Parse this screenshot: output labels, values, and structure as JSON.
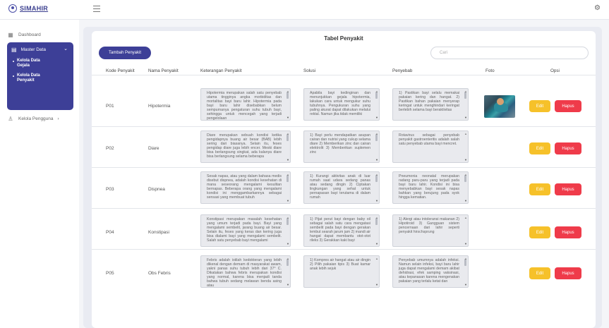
{
  "app": {
    "name": "SIMAHIR"
  },
  "sidebar": {
    "dashboard": "Dashboard",
    "master_data": "Master Data",
    "sub_items": [
      "Kelola Data Gejala",
      "Kelola Data Penyakit"
    ],
    "kelola_pengguna": "Kelola Pengguna"
  },
  "main": {
    "title": "Tabel Penyakit",
    "add_button": "Tambah Penyakit",
    "search_placeholder": "Cari",
    "columns": [
      "Kode Penyakit",
      "Nama Penyakit",
      "Keterangan Penyakit",
      "Solusi",
      "Penyebab",
      "Foto",
      "Opsi"
    ],
    "edit_label": "Edit",
    "delete_label": "Hapus",
    "rows": [
      {
        "kode": "P01",
        "nama": "Hipotermia",
        "keterangan": "Hipotermia merupakan salah satu penyebab utama tingginya angka morbiditas dan mortalitas bayi baru lahir. Hipotermia pada bayi baru lahir disebabkan belum sempurnanya pengaturan suhu tubuh bayi, sehingga untuk mencegah yang terjadi pengelolaan",
        "solusi": "Apabila bayi kedinginan dan menunjukkan gejala hipotermia, lakukan cara untuk mengukur suhu tubuhnya. Pengukuran suhu yang paling akurat dapat dilakukan melalui rektal. Namun jika tidak memiliki",
        "penyebab": "1) Pastikan bayi selalu memakai pakaian kering dan hangat. 2) Pastikan bahan pakaian menyerap keringat untuk menghindari keringat berlebih selama bayi beraktivitas",
        "has_photo": true
      },
      {
        "kode": "P02",
        "nama": "Diare",
        "keterangan": "Diare merupakan sebuah kondisi ketika pengidapnya buang air besar (BAB) lebih sering dari biasanya. Selain itu, feses pengidap diare juga lebih encer. Meski diare bisa berlangsung singkat, ada kalanya diare bisa berlangsung selama beberapa",
        "solusi": "1) Bayi perlu mendapatkan asupan cairan dan nutrisi yang cukup selama diare 2) Memberikan zinc dan cairan elektrolit 3) Memberikan suplemen zinc",
        "penyebab": "Rotavirus sebagai penyebab penyakit gastroenteritis adalah salah satu penyebab utama bayi mencret.",
        "has_photo": false
      },
      {
        "kode": "P03",
        "nama": "Dispnea",
        "keterangan": "Sesak napas, atau yang dalam bahasa medis disebut dispnea, adalah kondisi kesehatan di mana seseorang mengalami kesulitan bernapas. Beberapa orang yang mengalami kondisi ini menggambarkannya sebagai sensasi yang membuat tubuh",
        "solusi": "1) Kurangi aktivitas anak di luar rumah saat udara sedang panas atau sedang dingin 2) Ciptakan lingkungan yang sehat untuk pernapasan bayi terutama di dalam rumah",
        "penyebab": "Pneumonia neonatal merupakan radang paru-paru yang terjadi pada bayi baru lahir. Kondisi ini bisa menyebabkan bayi sesak napas bahkan yang berujung pada syok hingga kematian.",
        "has_photo": false
      },
      {
        "kode": "P04",
        "nama": "Konstipasi",
        "keterangan": "Konstipasi merupakan masalah kesehatan yang umum terjadi pada bayi. Bayi yang mengalami sembelit, jarang buang air besar. Selain itu, feses yang keras dan kering juga bisa dialami bayi yang mengalami sembelit. Salah satu penyebab bayi mengalami",
        "solusi": "1) Pijat perut bayi dengan baby oil sebagai salah satu cara mengatasi sembelit pada bayi dengan gerakan lembut searah jarum jam 2) mandi air hangat dapat membantu otot-otot rileks 3) Gerakkan kaki bayi",
        "penyebab": "1) Alergi atau intoleransi makanan 2) Hipotiroid 3) Gangguan sistem pencernaan dari lahir seperti penyakit hirschsprung",
        "has_photo": false
      },
      {
        "kode": "P05",
        "nama": "Obs Febris",
        "keterangan": "Febris adalah istilah kedokteran yang lebih dikenal dengan demam di masyarakat awam, yakni panas suhu tubuh lebih dari 37° C. Dikatakan bahwa febris merupakan kondisi yang normal, karena bisa menjadi tanda bahwa tubuh sedang melawan benda asing atau",
        "solusi": "1) Kompres air hangat atau air dingin 2) Pilih pakaian tipis 3) Buat kamar anak lebih sejuk",
        "penyebab": "Penyebab umumnya adalah infeksi. Namun selain infeksi, bayi baru lahir juga dapat mengalami demam akibat dehidrasi, efek samping vaksinasi, atau kepanasan karena mengenakan pakaian yang terlalu ketat dan",
        "has_photo": false
      }
    ]
  },
  "icons": {
    "dashboard": "grid-icon",
    "master": "database-icon",
    "users": "user-icon",
    "settings": "gear-icon",
    "menu": "hamburger-icon"
  },
  "colors": {
    "primary": "#3d3f97",
    "edit": "#f6c12a",
    "delete": "#ef3b4a"
  }
}
